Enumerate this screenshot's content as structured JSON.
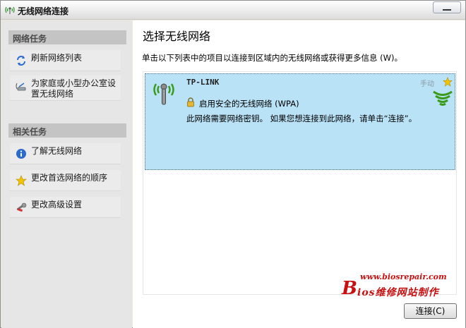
{
  "window": {
    "title": "无线网络连接"
  },
  "sidebar": {
    "network_tasks": {
      "heading": "网络任务",
      "items": [
        {
          "label": "刷新网络列表",
          "icon": "refresh-icon"
        },
        {
          "label": "为家庭或小型办公室设置无线网络",
          "icon": "setup-wireless-icon"
        }
      ]
    },
    "related_tasks": {
      "heading": "相关任务",
      "items": [
        {
          "label": "了解无线网络",
          "icon": "info-icon"
        },
        {
          "label": "更改首选网络的顺序",
          "icon": "star-icon"
        },
        {
          "label": "更改高级设置",
          "icon": "settings-wrench-icon"
        }
      ]
    }
  },
  "main": {
    "title": "选择无线网络",
    "description": "单击以下列表中的项目以连接到区域内的无线网络或获得更多信息 (W)。",
    "networks": [
      {
        "ssid": "TP-LINK",
        "security": "启用安全的无线网络 (WPA)",
        "note": "此网络需要网络密钥。 如果您想连接到此网络，请单击“连接”。",
        "favorite_label": "手动",
        "selected": true
      }
    ],
    "connect_label": "连接(C)"
  },
  "watermark": {
    "url": "www.biosrepair.com",
    "brand_b": "B",
    "brand_rest": "ios维修网站制作"
  },
  "colors": {
    "selected_bg": "#b9e2f7",
    "panel_head_bg": "#c4c4c4",
    "watermark": "#c81010",
    "signal": "#3a9a1a"
  }
}
